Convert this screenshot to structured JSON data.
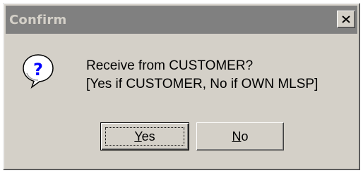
{
  "window": {
    "title": "Confirm",
    "close_glyph": "✕"
  },
  "message": {
    "line1": "Receive from CUSTOMER?",
    "line2": "[Yes if CUSTOMER, No if OWN MLSP]"
  },
  "icon": "question-icon",
  "buttons": {
    "yes": {
      "mnemonic": "Y",
      "rest": "es"
    },
    "no": {
      "mnemonic": "N",
      "rest": "o"
    }
  },
  "colors": {
    "dialog_face": "#d4d0c8",
    "titlebar_inactive": "#808080",
    "icon_blue": "#0000ff"
  }
}
